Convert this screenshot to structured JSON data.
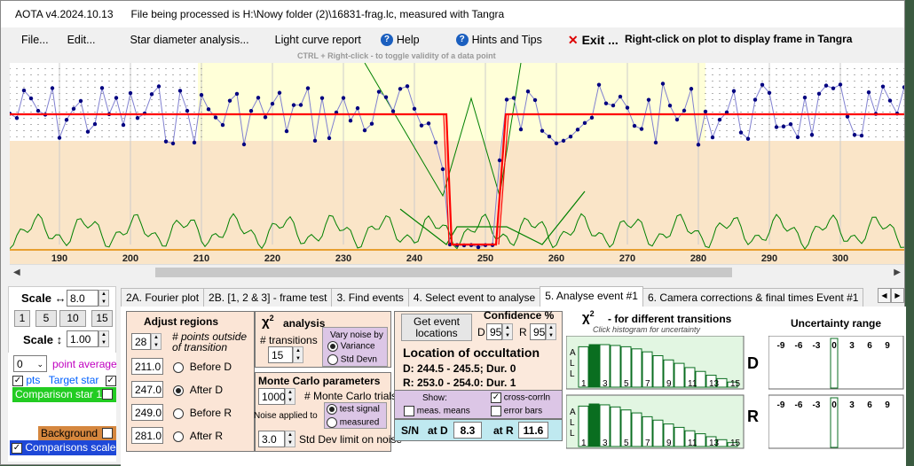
{
  "titlebar": {
    "version": "AOTA v4.2024.10.13",
    "file_text": "File being processed is H:\\Nowy folder (2)\\16831-frag.lc, measured with Tangra"
  },
  "menu": {
    "file": "File...",
    "edit": "Edit...",
    "star_diameter": "Star diameter analysis...",
    "light_curve": "Light curve report",
    "help": "Help",
    "hints": "Hints and Tips",
    "exit": "Exit ...",
    "right_click_note": "Right-click on plot to display frame in Tangra",
    "ctrl_note": "CTRL + Right-click  -  to toggle validity of a data point"
  },
  "plot": {
    "x_ticks": [
      "190",
      "200",
      "210",
      "220",
      "230",
      "240",
      "250",
      "260",
      "270",
      "280",
      "290",
      "300"
    ],
    "x_range": [
      183,
      309
    ],
    "event_D": 244.5,
    "event_R": 252.5,
    "colors": {
      "baseline": "#ff0000",
      "points": "#000080",
      "chi": "#008000",
      "bg_yellow": "#ffffd8",
      "bg_peach": "#fae5c8"
    }
  },
  "left": {
    "scale_h_label": "Scale ↔",
    "scale_h_value": "8.0",
    "steps": [
      "1",
      "5",
      "10",
      "15"
    ],
    "scale_v_label": "Scale ↕",
    "scale_v_value": "1.00",
    "avg_value": "0",
    "avg_label": "point average",
    "pts_label": "pts",
    "target_label": "Target star",
    "comparison1": "Comparison star 1",
    "background": "Background",
    "comparisons_scaled": "Comparisons scaled"
  },
  "tabs": [
    "2A. Fourier plot",
    "2B. [1, 2 & 3] - frame test",
    "3. Find events",
    "4. Select event to analyse",
    "5. Analyse event #1",
    "6. Camera corrections & final times Event #1"
  ],
  "adjust": {
    "title": "Adjust regions",
    "points_value": "28",
    "points_label": "# points outside of transition",
    "rows": [
      {
        "value": "211.0",
        "label": "Before D",
        "checked": false
      },
      {
        "value": "247.0",
        "label": "After D",
        "checked": true
      },
      {
        "value": "249.0",
        "label": "Before R",
        "checked": false
      },
      {
        "value": "281.0",
        "label": "After R",
        "checked": false
      }
    ]
  },
  "chi": {
    "title": "analysis",
    "transitions_label": "# transitions",
    "transitions_value": "15",
    "vary_title": "Vary noise by",
    "vary_opt1": "Variance",
    "vary_opt2": "Std Devn"
  },
  "monte": {
    "title": "Monte Carlo parameters",
    "trials_value": "1000",
    "trials_label": "# Monte Carlo trials",
    "noise_label": "Noise applied to",
    "opt1": "test signal",
    "opt2": "measured",
    "std_value": "3.0",
    "std_label": "Std Dev limit on noise"
  },
  "occ": {
    "get_btn": "Get event locations",
    "conf_title": "Confidence %",
    "d_label": "D",
    "d_value": "95",
    "r_label": "R",
    "r_value": "95",
    "loc_title": "Location of occultation",
    "d_line": "D: 244.5 - 245.5; Dur. 0",
    "r_line": "R: 253.0 - 254.0; Dur. 1",
    "show": "Show:",
    "cross": "cross-corrln",
    "means": "meas. means",
    "errbars": "error bars",
    "sn": "S/N",
    "atD": "at D",
    "atD_val": "8.3",
    "atR": "at R",
    "atR_val": "11.6"
  },
  "hist": {
    "title": "- for different transitions",
    "subtitle": "Click histogram for uncertainty",
    "all_letters": [
      "A",
      "L",
      "L"
    ],
    "x_labels": [
      "1",
      "3",
      "5",
      "7",
      "9",
      "11",
      "13",
      "15"
    ],
    "d_heights": [
      0.95,
      1.0,
      1.0,
      0.98,
      0.95,
      0.9,
      0.83,
      0.74,
      0.64,
      0.56,
      0.46,
      0.37,
      0.28,
      0.2,
      0.12
    ],
    "r_heights": [
      0.95,
      1.0,
      0.98,
      0.93,
      0.86,
      0.79,
      0.7,
      0.62,
      0.53,
      0.45,
      0.37,
      0.3,
      0.23,
      0.16,
      0.09
    ],
    "D": "D",
    "R": "R"
  },
  "unc": {
    "title": "Uncertainty range",
    "labels": [
      "-9",
      "-6",
      "-3",
      "0",
      "3",
      "6",
      "9"
    ]
  }
}
